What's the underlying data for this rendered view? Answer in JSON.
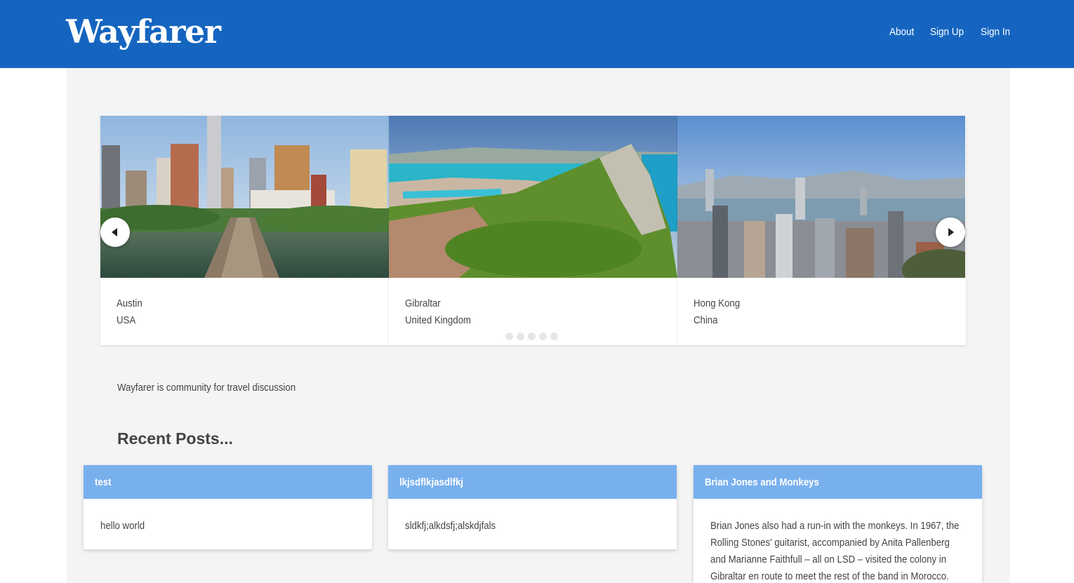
{
  "header": {
    "logo": "Wayfarer",
    "nav": [
      {
        "label": "About"
      },
      {
        "label": "Sign Up"
      },
      {
        "label": "Sign In"
      }
    ]
  },
  "carousel": {
    "slides": [
      {
        "city": "Austin",
        "country": "USA"
      },
      {
        "city": "Gibraltar",
        "country": "United Kingdom"
      },
      {
        "city": "Hong Kong",
        "country": "China"
      }
    ],
    "prev_icon": "chevron-left-icon",
    "next_icon": "chevron-right-icon",
    "dot_count": 5
  },
  "intro": {
    "tagline": "Wayfarer is community for travel discussion"
  },
  "recent": {
    "title": "Recent Posts...",
    "posts": [
      {
        "title": "test",
        "body": "hello world"
      },
      {
        "title": "lkjsdflkjasdlfkj",
        "body": "sldkfj;alkdsfj;alskdjfals"
      },
      {
        "title": "Brian Jones and Monkeys",
        "body": "Brian Jones also had a run-in with the monkeys. In 1967, the Rolling Stones' guitarist, accompanied by Anita Pallenberg and Marianne Faithfull – all on LSD – visited the colony in Gibraltar en route to meet the rest of the band in Morocco."
      }
    ]
  },
  "colors": {
    "navbar": "#1565c0",
    "card_header": "#78b0ee",
    "page_panel": "#f4f4f4"
  }
}
